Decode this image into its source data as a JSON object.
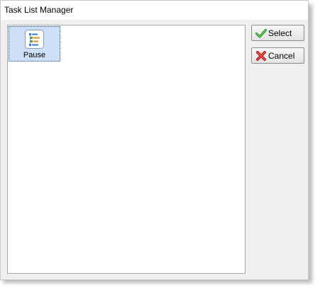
{
  "window": {
    "title": "Task List Manager"
  },
  "task_list": {
    "items": [
      {
        "label": "Pause",
        "icon": "task-list-icon",
        "selected": true
      }
    ]
  },
  "buttons": {
    "select_label": "Select",
    "select_icon": "checkmark-icon",
    "cancel_label": "Cancel",
    "cancel_icon": "x-mark-icon"
  },
  "colors": {
    "selection_bg": "#cde0f7",
    "check_green": "#3aa335",
    "cancel_red": "#d9342b"
  }
}
